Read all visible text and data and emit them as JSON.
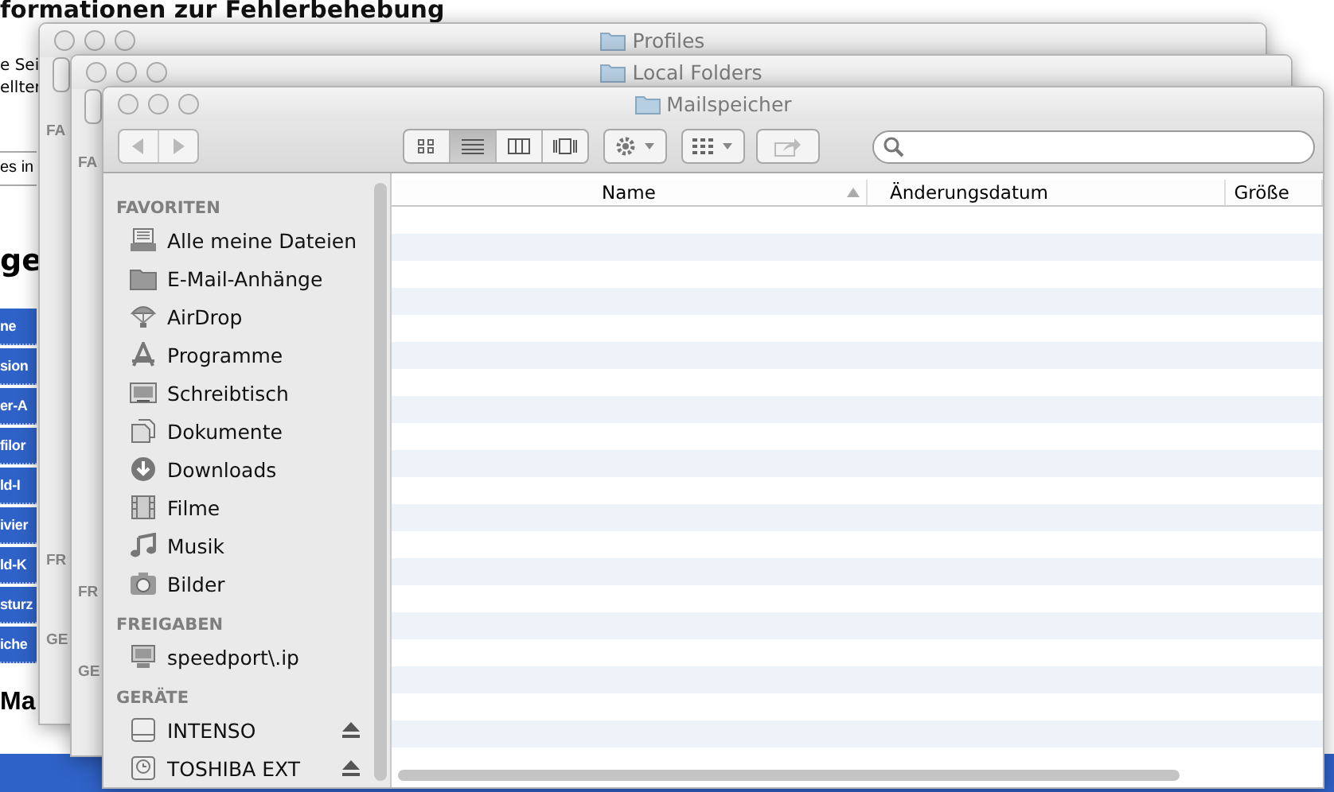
{
  "page": {
    "heading": "formationen zur Fehlerbehebung",
    "text_lines": [
      "e Sei",
      "ellter"
    ],
    "field_text": "es in",
    "subheading": "ge",
    "list_items": [
      "ne",
      "sion",
      "er-A",
      "filor",
      "ld-I",
      "ivier",
      "ld-K",
      "sturz",
      "iche"
    ],
    "subheading_2": "Ma"
  },
  "background_windows": [
    {
      "title": "Profiles",
      "sidebar_headings": [
        "FA",
        "FR",
        "GE"
      ]
    },
    {
      "title": "Local Folders",
      "sidebar_headings": [
        "FA",
        "FR",
        "GE"
      ]
    }
  ],
  "window": {
    "title": "Mailspeicher",
    "view_modes": [
      {
        "kind": "icons",
        "selected": false
      },
      {
        "kind": "list",
        "selected": true
      },
      {
        "kind": "columns",
        "selected": false
      },
      {
        "kind": "coverflow",
        "selected": false
      }
    ],
    "sidebar": [
      {
        "title": "FAVORITEN",
        "items": [
          {
            "label": "Alle meine Dateien",
            "kind": "files"
          },
          {
            "label": "E-Mail-Anhänge",
            "kind": "folder"
          },
          {
            "label": "AirDrop",
            "kind": "airdrop"
          },
          {
            "label": "Programme",
            "kind": "apps"
          },
          {
            "label": "Schreibtisch",
            "kind": "desktop"
          },
          {
            "label": "Dokumente",
            "kind": "documents"
          },
          {
            "label": "Downloads",
            "kind": "downloads"
          },
          {
            "label": "Filme",
            "kind": "movies"
          },
          {
            "label": "Musik",
            "kind": "music"
          },
          {
            "label": "Bilder",
            "kind": "pictures"
          }
        ]
      },
      {
        "title": "FREIGABEN",
        "items": [
          {
            "label": "speedport\\.ip",
            "kind": "computer"
          }
        ]
      },
      {
        "title": "GERÄTE",
        "items": [
          {
            "label": "INTENSO",
            "kind": "disk",
            "ejectable": true
          },
          {
            "label": "TOSHIBA EXT",
            "kind": "timemachine",
            "ejectable": true
          }
        ]
      }
    ],
    "columns": [
      {
        "label": "Name",
        "sorted": true
      },
      {
        "label": "Änderungsdatum",
        "sorted": false
      },
      {
        "label": "Größe",
        "sorted": false
      }
    ]
  }
}
